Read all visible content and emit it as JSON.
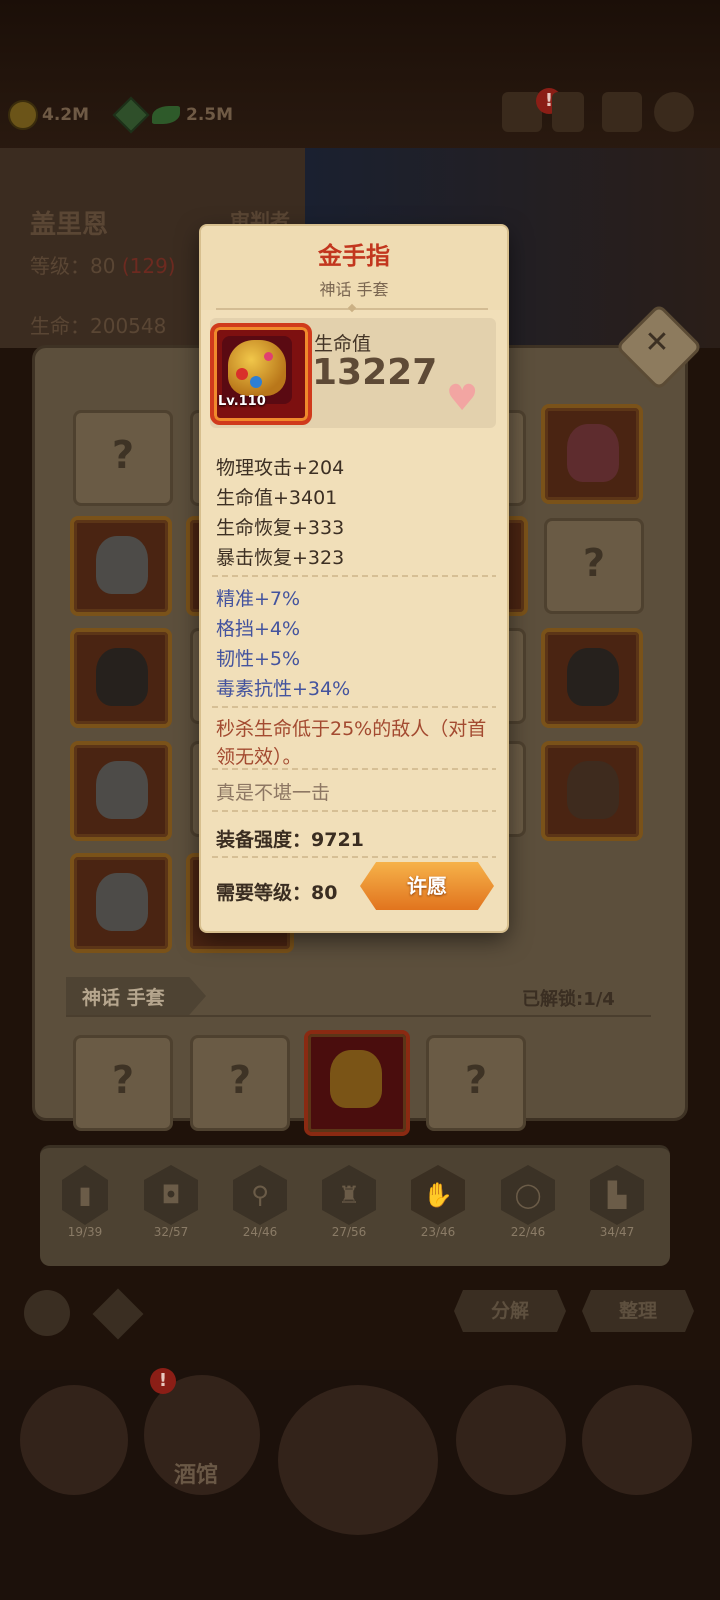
{
  "resources": [
    {
      "name": "gold",
      "value": "4.2M",
      "icon": "gold-coin-icon"
    },
    {
      "name": "leaf",
      "value": "2.5M",
      "icon": "leaf-icon"
    }
  ],
  "top_alert_icon": "!",
  "hero": {
    "name": "盖里恩",
    "role": "审判者",
    "level_label": "等级：",
    "level": "80",
    "level_extra": "(129)",
    "hp_label": "生命：",
    "hp": "200548"
  },
  "item": {
    "name": "金手指",
    "subtitle": "神话 手套",
    "level_badge": "Lv.110",
    "main_stat_name": "生命值",
    "main_stat_value": "13227",
    "base_stats": [
      "物理攻击+204",
      "生命值+3401",
      "生命恢复+333",
      "暴击恢复+323"
    ],
    "bonus_stats": [
      "精准+7%",
      "格挡+4%",
      "韧性+5%",
      "毒素抗性+34%"
    ],
    "special_effect": "秒杀生命低于25%的敌人（对首领无效）。",
    "flavor": "真是不堪一击",
    "power_label": "装备强度：",
    "power_value": "9721",
    "required_label": "需要等级：",
    "required_value": "80",
    "wish_button": "许愿"
  },
  "collection": {
    "category_label": "神话 手套",
    "unlocked": "已解锁:1/4",
    "unknown_mark": "?"
  },
  "tabs": [
    {
      "icon": "book-icon",
      "count": "19/39"
    },
    {
      "icon": "armor-icon",
      "count": "32/57"
    },
    {
      "icon": "mirror-icon",
      "count": "24/46"
    },
    {
      "icon": "shirt-icon",
      "count": "27/56"
    },
    {
      "icon": "glove-icon",
      "count": "23/46"
    },
    {
      "icon": "ring-icon",
      "count": "22/46"
    },
    {
      "icon": "boot-icon",
      "count": "34/47"
    }
  ],
  "actions": {
    "decompose": "分解",
    "sort": "整理"
  },
  "bottom_nav": {
    "tavern": "酒馆"
  },
  "colors": {
    "title_red": "#c2361e",
    "bonus_blue": "#43539e",
    "effect_red": "#a34a30",
    "wish_orange": "#e1741e"
  }
}
